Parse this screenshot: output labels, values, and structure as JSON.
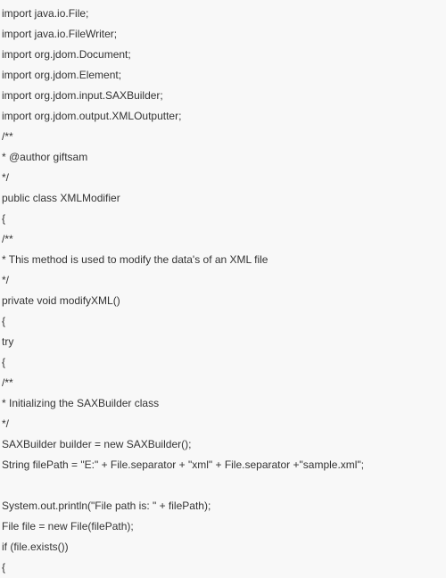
{
  "code": {
    "lines": [
      "import java.io.File;",
      "import java.io.FileWriter;",
      "import org.jdom.Document;",
      "import org.jdom.Element;",
      "import org.jdom.input.SAXBuilder;",
      "import org.jdom.output.XMLOutputter;",
      "/**",
      "* @author giftsam",
      "*/",
      "public class XMLModifier",
      "{",
      "/**",
      "* This method is used to modify the data's of an XML file",
      "*/",
      "private void modifyXML()",
      "{",
      "try",
      "{",
      "/**",
      "* Initializing the SAXBuilder class",
      "*/",
      "SAXBuilder builder = new SAXBuilder();",
      "String filePath = \"E:\" + File.separator + \"xml\" + File.separator +\"sample.xml\";",
      " ",
      "System.out.println(\"File path is: \" + filePath);",
      "File file = new File(filePath);",
      "if (file.exists())",
      "{"
    ]
  }
}
